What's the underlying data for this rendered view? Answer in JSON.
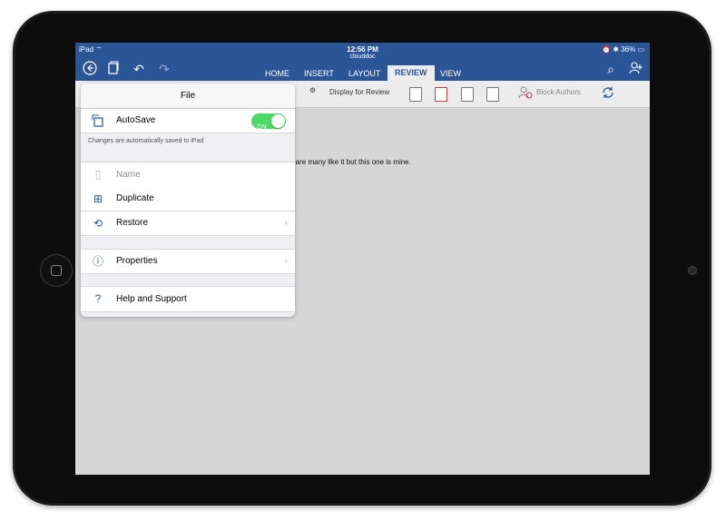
{
  "status": {
    "carrier": "iPad",
    "time": "12:56 PM",
    "document": "clouddoc",
    "battery": "36%"
  },
  "ribbon": {
    "tabs": [
      {
        "label": "HOME"
      },
      {
        "label": "INSERT"
      },
      {
        "label": "LAYOUT"
      },
      {
        "label": "REVIEW"
      },
      {
        "label": "VIEW"
      }
    ]
  },
  "toolbar": {
    "display_label": "Display for Review",
    "block_label": "Block Authors"
  },
  "document": {
    "visible_text": "e are many like it but this one is mine."
  },
  "file_menu": {
    "title": "File",
    "autosave_label": "AutoSave",
    "autosave_state": "ON",
    "autosave_note": "Changes are automatically saved to iPad",
    "name_label": "Name",
    "duplicate_label": "Duplicate",
    "restore_label": "Restore",
    "properties_label": "Properties",
    "help_label": "Help and Support"
  },
  "colors": {
    "ribbon": "#2a5597",
    "toggle_on": "#4cd964",
    "accent_icon": "#2a5597"
  }
}
